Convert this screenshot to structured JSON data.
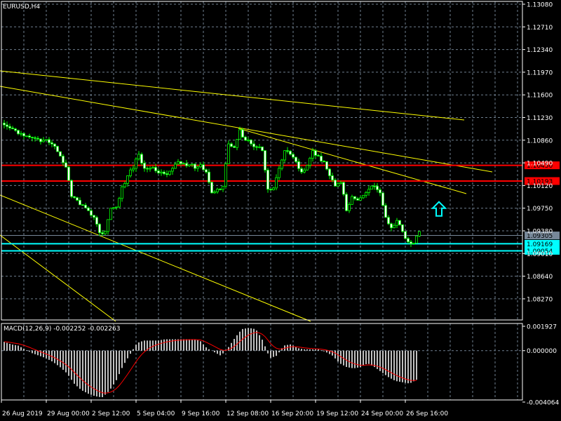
{
  "window": {
    "symbol_title": "EURUSD,H4"
  },
  "colors": {
    "background": "#000000",
    "grid": "#6f7f8f",
    "bull_body": "#000000",
    "bear_body": "#ffffff",
    "candle_outline": "#00ff00",
    "trendline": "#ffff00",
    "resistance": "#ff0000",
    "support": "#00ffff",
    "bid_line": "#778899",
    "macd_histogram": "#c0c0c0",
    "macd_signal": "#ff0000"
  },
  "price_axis": {
    "ticks": [
      "1.13080",
      "1.12710",
      "1.12340",
      "1.11970",
      "1.11600",
      "1.11230",
      "1.10860",
      "1.10490",
      "1.10120",
      "1.09750",
      "1.09380",
      "1.09010",
      "1.08640",
      "1.08270"
    ],
    "range": [
      1.079,
      1.1308
    ]
  },
  "horizontal_levels": [
    {
      "label": "1.10450",
      "price": 1.1045,
      "kind": "resistance"
    },
    {
      "label": "1.10193",
      "price": 1.10193,
      "kind": "resistance"
    },
    {
      "label": "1.09305",
      "price": 1.09305,
      "kind": "bid"
    },
    {
      "label": "1.09169",
      "price": 1.09169,
      "kind": "support"
    },
    {
      "label": "1.09054",
      "price": 1.09054,
      "kind": "support"
    }
  ],
  "arrow": {
    "icon": "up-arrow-icon",
    "price": 1.0975
  },
  "time_axis": {
    "labels": [
      "26 Aug 2019",
      "29 Aug 00:00",
      "2 Sep 12:00",
      "5 Sep 04:00",
      "9 Sep 16:00",
      "12 Sep 08:00",
      "16 Sep 20:00",
      "19 Sep 12:00",
      "24 Sep 00:00",
      "26 Sep 16:00"
    ]
  },
  "chart_data": [
    {
      "type": "candlestick",
      "title": "EURUSD,H4",
      "ylim": [
        1.079,
        1.1308
      ],
      "grid": true,
      "closes": [
        1.1111,
        1.1106,
        1.1102,
        1.1097,
        1.1093,
        1.109,
        1.1088,
        1.1086,
        1.1082,
        1.1076,
        1.106,
        1.1042,
        1.0994,
        1.0988,
        1.098,
        1.0971,
        1.096,
        1.0935,
        1.0937,
        1.0975,
        1.0977,
        1.101,
        1.1028,
        1.104,
        1.1063,
        1.104,
        1.104,
        1.1036,
        1.1034,
        1.103,
        1.104,
        1.1051,
        1.1048,
        1.1046,
        1.104,
        1.1046,
        1.1034,
        1.1,
        1.1006,
        1.1011,
        1.108,
        1.1074,
        1.1103,
        1.1086,
        1.108,
        1.1075,
        1.1069,
        1.1006,
        1.1008,
        1.104,
        1.1069,
        1.1063,
        1.1051,
        1.1034,
        1.1045,
        1.1069,
        1.106,
        1.1051,
        1.1028,
        1.1011,
        1.1017,
        1.0971,
        1.0994,
        1.0988,
        1.0996,
        1.1006,
        1.1011,
        1.1,
        1.096,
        1.0943,
        1.0955,
        1.0937,
        1.092,
        1.0918,
        1.0937
      ]
    },
    {
      "type": "bar",
      "title": "MACD(12,26,9) -0.002252 -0.002263",
      "ylim": [
        -0.004064,
        0.001927
      ],
      "yticks": [
        "0.001927",
        "0.000000",
        "-0.004064"
      ],
      "macd": [
        0.0007,
        0.0005,
        0.0004,
        0.0001,
        -0.0002,
        -0.0004,
        -0.0006,
        -0.0009,
        -0.0013,
        -0.0018,
        -0.0026,
        -0.0031,
        -0.0034,
        -0.0036,
        -0.0037,
        -0.0032,
        -0.0024,
        -0.0012,
        -0.0003,
        0.0006,
        0.0008,
        0.0008,
        0.0008,
        0.0009,
        0.0009,
        0.0009,
        0.0009,
        0.0009,
        0.0008,
        0.0002,
        -0.0001,
        -0.0004,
        0.0002,
        0.001,
        0.0017,
        0.0018,
        0.0017,
        0.0008,
        -0.0006,
        -0.0004,
        0.0004,
        0.0005,
        0.0002,
        0.0001,
        0.0001,
        0.0001,
        -0.0001,
        -0.0004,
        -0.001,
        -0.0013,
        -0.0014,
        -0.0013,
        -0.001,
        -0.0013,
        -0.0017,
        -0.0021,
        -0.0024,
        -0.0025,
        -0.0026,
        -0.0023
      ]
    }
  ]
}
